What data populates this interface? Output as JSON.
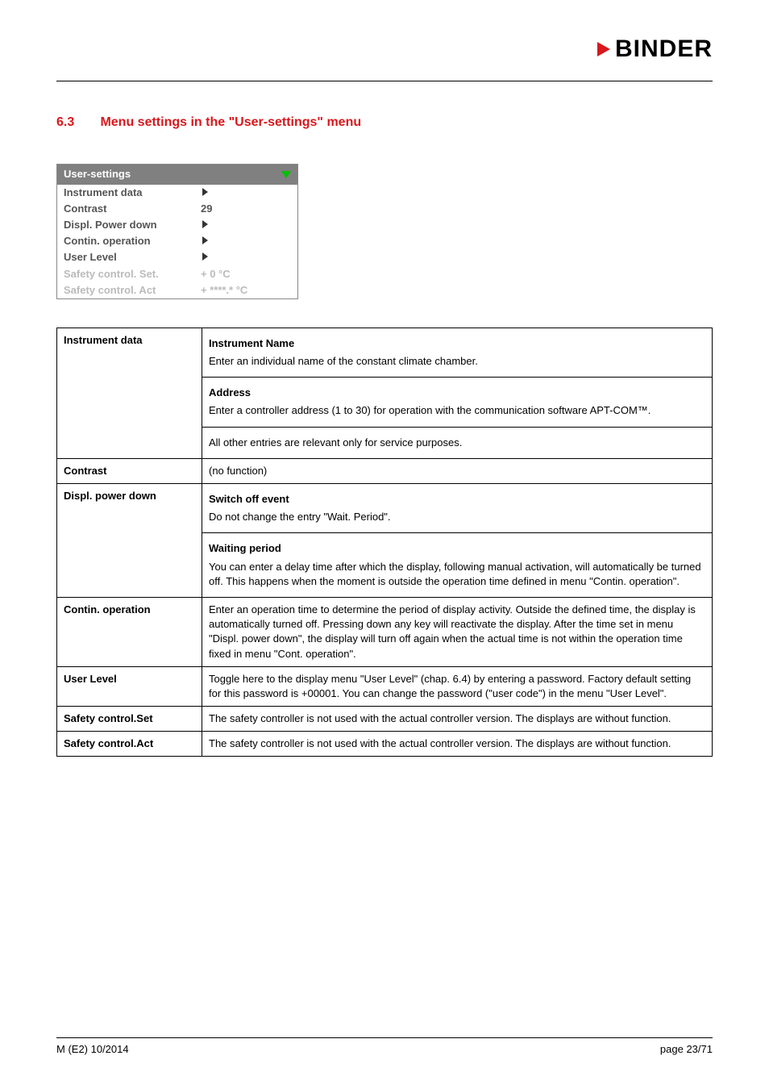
{
  "brand": {
    "name": "BINDER"
  },
  "heading": {
    "num": "6.3",
    "title": "Menu settings in the \"User-settings\" menu"
  },
  "panel": {
    "title": "User-settings",
    "rows": [
      {
        "label": "Instrument data",
        "type": "arrow"
      },
      {
        "label": "Contrast",
        "type": "value",
        "value": "29"
      },
      {
        "label": "Displ. Power down",
        "type": "arrow"
      },
      {
        "label": "Contin. operation",
        "type": "arrow"
      },
      {
        "label": "User Level",
        "type": "arrow"
      },
      {
        "label": "Safety control. Set.",
        "type": "grey",
        "value": "+       0  °C"
      },
      {
        "label": "Safety control. Act",
        "type": "grey",
        "value": "+  ****.*  °C"
      }
    ]
  },
  "table": {
    "rows": [
      {
        "name": "Instrument data",
        "sections": [
          {
            "heading": "Instrument Name",
            "body": "Enter an individual name of the constant climate chamber."
          },
          {
            "heading": "Address",
            "body": "Enter a controller address (1 to 30) for operation with the communication software APT-COM™."
          },
          {
            "body": "All other entries are relevant only for service purposes."
          }
        ]
      },
      {
        "name": "Contrast",
        "plain": "(no function)"
      },
      {
        "name": "Displ. power down",
        "sections": [
          {
            "heading": "Switch off event",
            "body": "Do not change the entry \"Wait. Period\"."
          },
          {
            "heading": "Waiting period",
            "body": "You can enter a delay time after which the display, following manual activation, will automatically be turned off. This happens when the moment is outside the operation time defined in menu \"Contin. operation\"."
          }
        ]
      },
      {
        "name": "Contin. operation",
        "plain": "Enter an operation time to determine the period of display activity. Outside the defined time, the display is automatically turned off. Pressing down any key will reactivate the display. After the time set in menu \"Displ. power down\", the display will turn off again when the actual time is not within the operation time fixed in menu \"Cont. operation\"."
      },
      {
        "name": "User Level",
        "plain": "Toggle here to the display menu \"User Level\" (chap. 6.4) by entering a password. Factory default setting for this password is +00001. You can change the password (\"user code\") in the menu \"User Level\"."
      },
      {
        "name": "Safety control.Set",
        "plain": "The safety controller is not used with the actual controller version. The displays are without function."
      },
      {
        "name": "Safety control.Act",
        "plain": "The safety controller is not used with the actual controller version. The displays are without function."
      }
    ]
  },
  "footer": {
    "left": "M (E2) 10/2014",
    "right": "page 23/71"
  }
}
